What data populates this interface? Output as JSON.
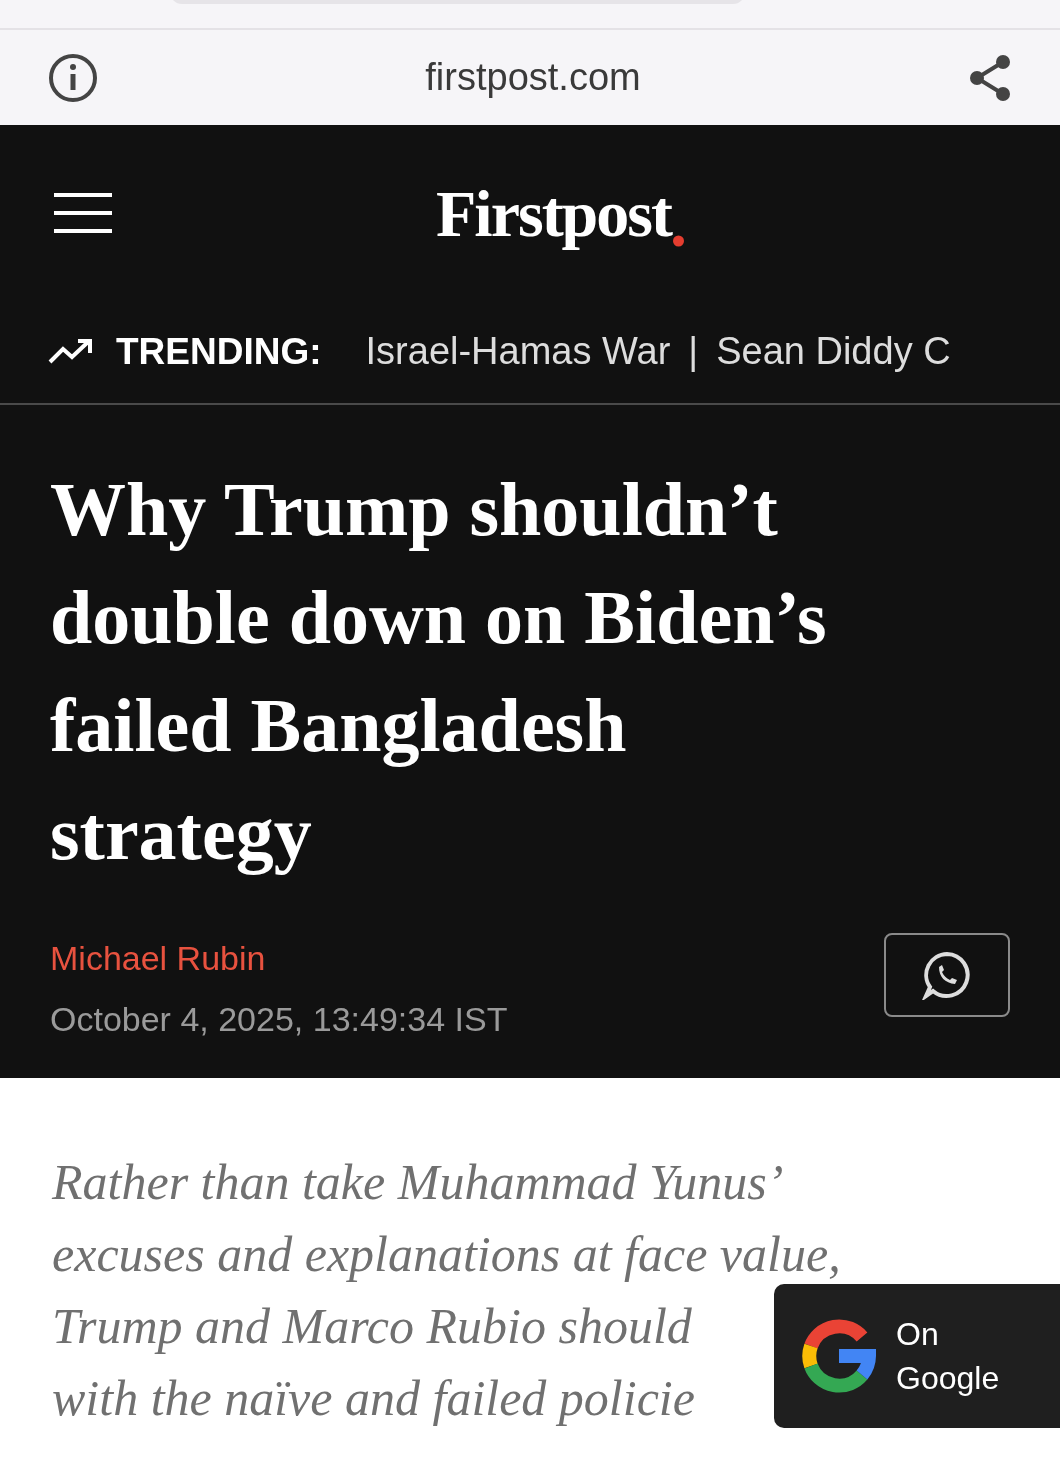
{
  "browser_bar": {
    "url": "firstpost.com"
  },
  "site_header": {
    "logo": "Firstpost"
  },
  "trending": {
    "label": "TRENDING:",
    "items": [
      "Israel-Hamas War",
      "Sean Diddy C"
    ],
    "separator": "|"
  },
  "article": {
    "title_lines": [
      "Why Trump shouldn’t",
      "double down on Biden’s",
      "failed Bangladesh",
      "strategy"
    ],
    "author": "Michael Rubin",
    "date": "October 4, 2025, 13:49:34 IST",
    "summary_lines": [
      "Rather than take Muhammad Yunus’",
      "excuses and explanations at face value,",
      "Trump and Marco Rubio should",
      "with the naïve and failed policie"
    ]
  },
  "google_badge": {
    "lines": [
      "On",
      "Google"
    ]
  }
}
